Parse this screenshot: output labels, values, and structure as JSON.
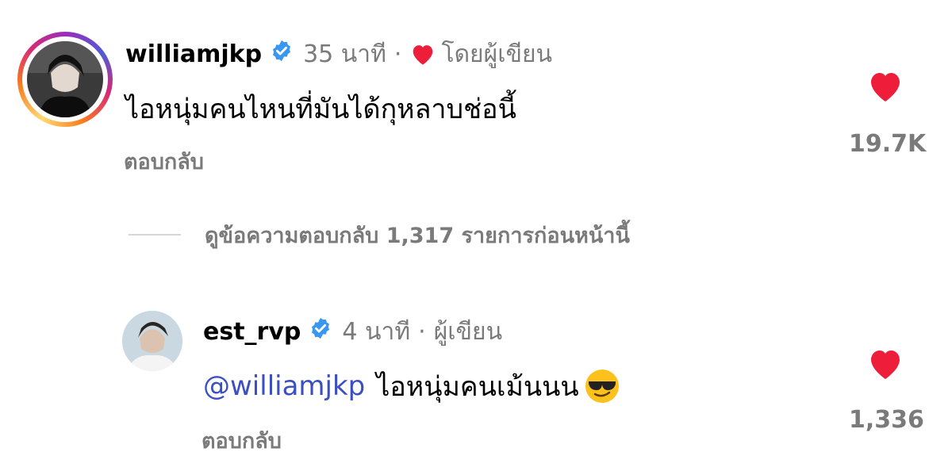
{
  "comments": [
    {
      "username": "williamjkp",
      "verified": true,
      "time": "35 นาที",
      "separator": "·",
      "author_liked_label": "โดยผู้เขียน",
      "text": "ไอหนุ่มคนไหนที่มันได้กุหลาบช่อนี้",
      "reply_label": "ตอบกลับ",
      "like_count": "19.7K",
      "liked": true,
      "has_story_ring": true
    },
    {
      "username": "est_rvp",
      "verified": true,
      "time": "4 นาที",
      "separator": "·",
      "author_label": "ผู้เขียน",
      "mention": "@williamjkp",
      "text": "ไอหนุ่มคนเม้นนน",
      "emoji": "😎",
      "reply_label": "ตอบกลับ",
      "like_count": "1,336",
      "liked": true,
      "has_story_ring": false
    }
  ],
  "view_replies": {
    "label": "ดูข้อความตอบกลับ 1,317 รายการก่อนหน้านี้"
  },
  "colors": {
    "heart": "#ee1d3a",
    "verified": "#3897f0",
    "mention": "#3b4fc4",
    "muted": "#7a7a7a"
  }
}
